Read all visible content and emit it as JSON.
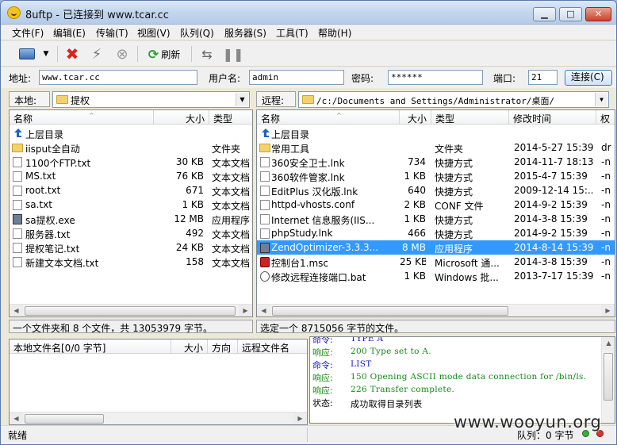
{
  "window": {
    "title": "8uftp - 已连接到 www.tcar.cc",
    "min_label": "▁",
    "max_label": "□",
    "close_label": "✕"
  },
  "menu": [
    "文件(F)",
    "编辑(E)",
    "传输(T)",
    "视图(V)",
    "队列(Q)",
    "服务器(S)",
    "工具(T)",
    "帮助(H)"
  ],
  "toolbar": {
    "refresh_label": "刷新"
  },
  "connection": {
    "address_label": "地址:",
    "address_value": "www.tcar.cc",
    "user_label": "用户名:",
    "user_value": "admin",
    "password_label": "密码:",
    "password_value": "******",
    "port_label": "端口:",
    "port_value": "21",
    "connect_label": "连接(C)"
  },
  "local": {
    "path_label": "本地:",
    "path_value": "提权",
    "columns": [
      "名称",
      "大小",
      "类型"
    ],
    "rows": [
      {
        "name": "上层目录",
        "size": "",
        "type": "",
        "icon": "up"
      },
      {
        "name": "iisput全自动",
        "size": "",
        "type": "文件夹",
        "icon": "folder"
      },
      {
        "name": "1100个FTP.txt",
        "size": "30 KB",
        "type": "文本文档",
        "icon": "file"
      },
      {
        "name": "MS.txt",
        "size": "76 KB",
        "type": "文本文档",
        "icon": "file"
      },
      {
        "name": "root.txt",
        "size": "671",
        "type": "文本文档",
        "icon": "file"
      },
      {
        "name": "sa.txt",
        "size": "1 KB",
        "type": "文本文档",
        "icon": "file"
      },
      {
        "name": "sa提权.exe",
        "size": "12 MB",
        "type": "应用程序",
        "icon": "exe"
      },
      {
        "name": "服务器.txt",
        "size": "492",
        "type": "文本文档",
        "icon": "file"
      },
      {
        "name": "提权笔记.txt",
        "size": "24 KB",
        "type": "文本文档",
        "icon": "file"
      },
      {
        "name": "新建文本文档.txt",
        "size": "158",
        "type": "文本文档",
        "icon": "file"
      }
    ],
    "status": "一个文件夹和 8 个文件，共 13053979 字节。"
  },
  "remote": {
    "path_label": "远程:",
    "path_value": "/c:/Documents and Settings/Administrator/桌面/",
    "columns": [
      "名称",
      "大小",
      "类型",
      "修改时间",
      "权"
    ],
    "rows": [
      {
        "name": "上层目录",
        "size": "",
        "type": "",
        "date": "",
        "perm": "",
        "icon": "up"
      },
      {
        "name": "常用工具",
        "size": "",
        "type": "文件夹",
        "date": "2014-5-27 15:39",
        "perm": "dr",
        "icon": "folder"
      },
      {
        "name": "360安全卫士.lnk",
        "size": "734",
        "type": "快捷方式",
        "date": "2014-11-7 18:13",
        "perm": "-n",
        "icon": "file"
      },
      {
        "name": "360软件管家.lnk",
        "size": "1 KB",
        "type": "快捷方式",
        "date": "2015-4-7 15:39",
        "perm": "-n",
        "icon": "file"
      },
      {
        "name": "EditPlus 汉化版.lnk",
        "size": "640",
        "type": "快捷方式",
        "date": "2009-12-14 15:...",
        "perm": "-n",
        "icon": "file"
      },
      {
        "name": "httpd-vhosts.conf",
        "size": "2 KB",
        "type": "CONF 文件",
        "date": "2014-9-2 15:39",
        "perm": "-n",
        "icon": "file"
      },
      {
        "name": "Internet 信息服务(IIS...",
        "size": "1 KB",
        "type": "快捷方式",
        "date": "2014-3-8 15:39",
        "perm": "-n",
        "icon": "file"
      },
      {
        "name": "phpStudy.lnk",
        "size": "466",
        "type": "快捷方式",
        "date": "2014-9-2 15:39",
        "perm": "-n",
        "icon": "file"
      },
      {
        "name": "ZendOptimizer-3.3.3...",
        "size": "8 MB",
        "type": "应用程序",
        "date": "2014-8-14 15:39",
        "perm": "-n",
        "icon": "exe",
        "selected": true
      },
      {
        "name": "控制台1.msc",
        "size": "25 KB",
        "type": "Microsoft 通...",
        "date": "2014-3-8 15:39",
        "perm": "-n",
        "icon": "msc"
      },
      {
        "name": "修改远程连接端口.bat",
        "size": "1 KB",
        "type": "Windows 批...",
        "date": "2013-7-17 15:39",
        "perm": "-n",
        "icon": "bat"
      }
    ],
    "status": "选定一个 8715056 字节的文件。"
  },
  "queue": {
    "columns": [
      "本地文件名[0/0 字节]",
      "大小",
      "方向",
      "远程文件名"
    ]
  },
  "log": [
    {
      "key": "命令:",
      "value": "TYPE A",
      "color": "#1515c8"
    },
    {
      "key": "响应:",
      "value": "200 Type set to A.",
      "color": "#138a13"
    },
    {
      "key": "命令:",
      "value": "LIST",
      "color": "#1515c8"
    },
    {
      "key": "响应:",
      "value": "150 Opening ASCII mode data connection for /bin/ls.",
      "color": "#138a13"
    },
    {
      "key": "响应:",
      "value": "226 Transfer complete.",
      "color": "#138a13"
    },
    {
      "key": "状态:",
      "value": "成功取得目录列表",
      "color": "#000000"
    }
  ],
  "statusbar": {
    "ready": "就绪",
    "queue": "队列：0 字节"
  },
  "watermark": "www.wooyun.org",
  "colors": {
    "selection": "#3399ff",
    "command": "#1515c8",
    "response": "#138a13"
  }
}
